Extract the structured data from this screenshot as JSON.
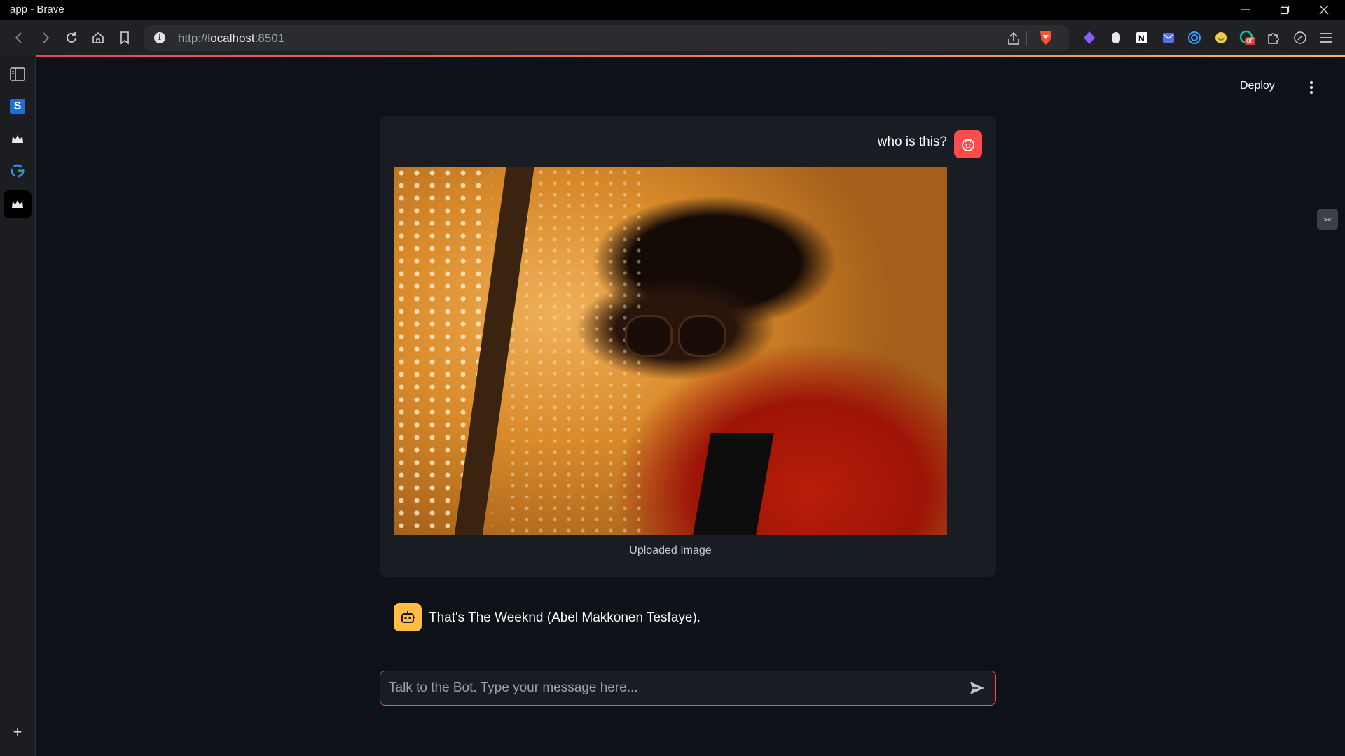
{
  "window": {
    "title": "app - Brave"
  },
  "browser": {
    "url_scheme": "http://",
    "url_host": "localhost",
    "url_port": ":8501",
    "extensions": [
      "gem-icon",
      "mouse-icon",
      "notion-icon",
      "mail-icon",
      "target-icon",
      "smile-icon",
      "grammarly-icon",
      "puzzle-icon",
      "leaf-icon"
    ],
    "extension_badge": "off"
  },
  "sidebar": {
    "items": [
      {
        "icon": "sidebar-panel-icon"
      },
      {
        "icon": "s-app-icon",
        "label": "S"
      },
      {
        "icon": "crown-icon"
      },
      {
        "icon": "google-icon",
        "label": "G"
      },
      {
        "icon": "crown-icon"
      }
    ],
    "add_label": "+"
  },
  "app": {
    "deploy_label": "Deploy",
    "widget_label": "><"
  },
  "chat": {
    "user_message": "who is this?",
    "image_caption": "Uploaded Image",
    "bot_message": "That's The Weeknd (Abel Makkonen Tesfaye).",
    "input_placeholder": "Talk to the Bot. Type your message here..."
  },
  "colors": {
    "background": "#0e1117",
    "accent_red": "#ff4b4b",
    "bot_yellow": "#ffbd45"
  }
}
